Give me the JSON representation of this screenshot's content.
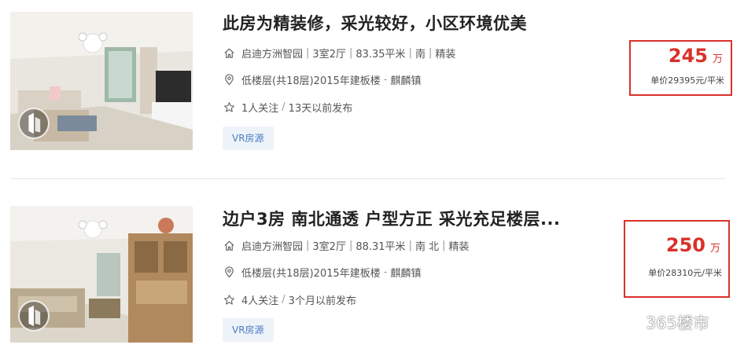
{
  "listings": [
    {
      "title": "此房为精装修，采光较好，小区环境优美",
      "community": "启迪方洲智园",
      "layout": "3室2厅",
      "area": "83.35平米",
      "orientation": "南",
      "decoration": "精装",
      "floor": "低楼层(共18层)2015年建板楼",
      "district": "麒麟镇",
      "followers": "1人关注",
      "published": "13天以前发布",
      "vr_tag": "VR房源",
      "price": "245",
      "price_unit": "万",
      "unit_price": "单价29395元/平米"
    },
    {
      "title": "边户3房 南北通透 户型方正 采光充足楼层...",
      "community": "启迪方洲智园",
      "layout": "3室2厅",
      "area": "88.31平米",
      "orientation": "南 北",
      "decoration": "精装",
      "floor": "低楼层(共18层)2015年建板楼",
      "district": "麒麟镇",
      "followers": "4人关注",
      "published": "3个月以前发布",
      "vr_tag": "VR房源",
      "price": "250",
      "price_unit": "万",
      "unit_price": "单价28310元/平米"
    }
  ],
  "separators": {
    "pipe": "|",
    "dash": "-",
    "slash": "/"
  },
  "watermark": {
    "text": "365楼市"
  },
  "icons": {
    "house": "house-icon",
    "location": "location-pin-icon",
    "follow": "star-icon",
    "vr": "vr-icon"
  },
  "colors": {
    "price_red": "#d9312a",
    "vr_tag_bg": "#eef3fa",
    "vr_tag_text": "#4a7cc0"
  }
}
